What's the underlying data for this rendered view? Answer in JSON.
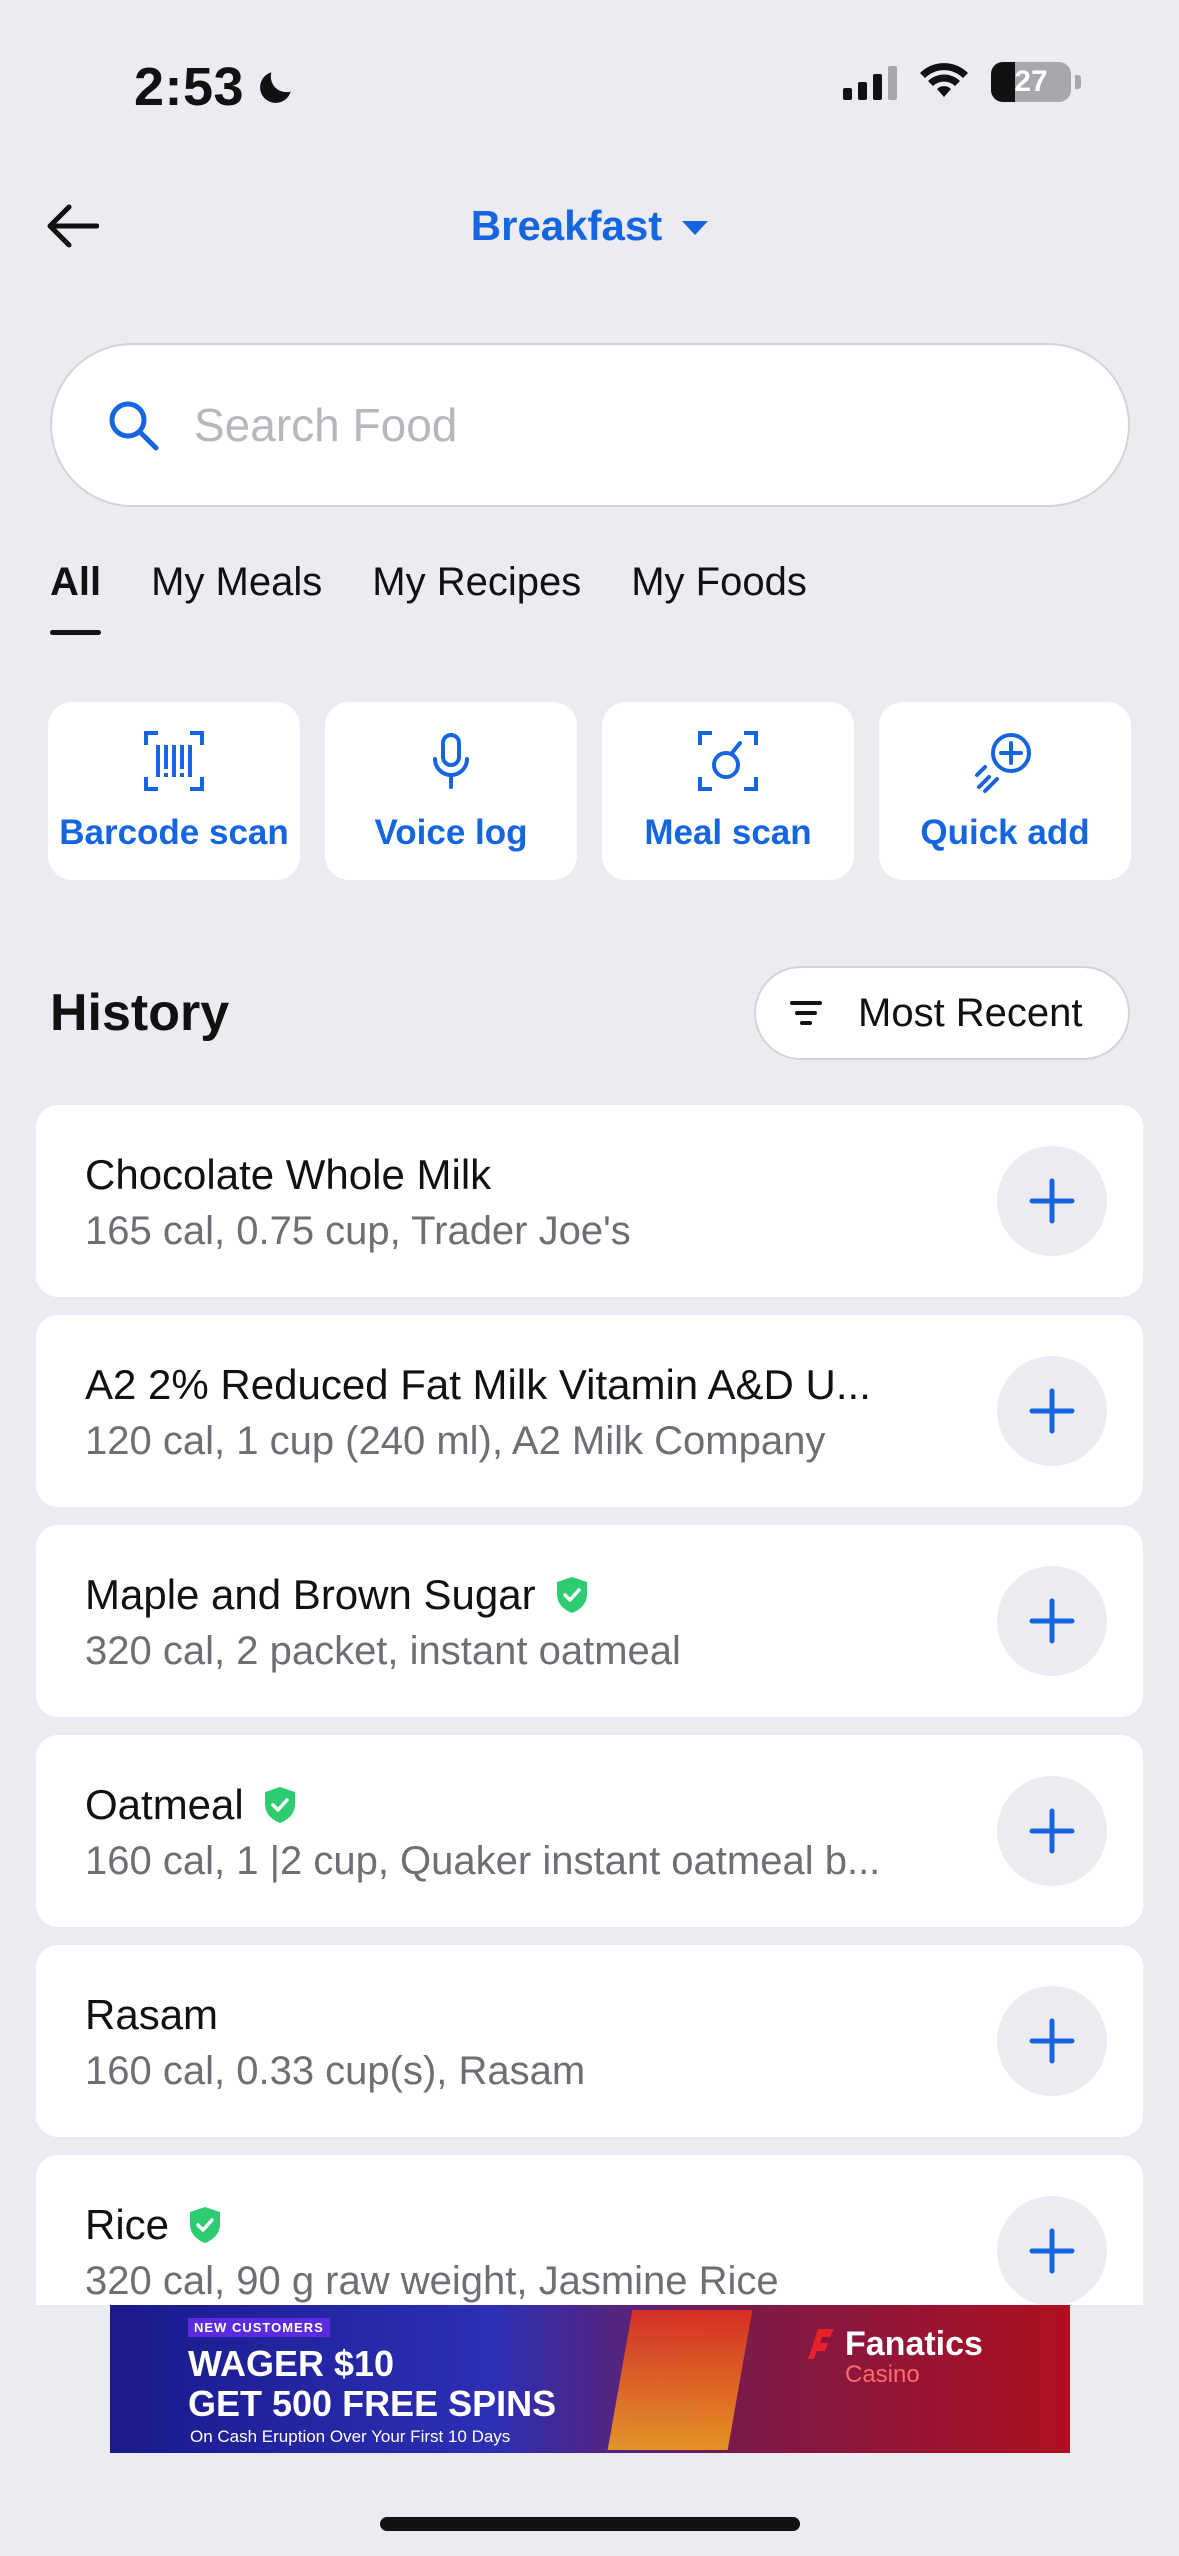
{
  "status_bar": {
    "time": "2:53",
    "battery": "27"
  },
  "nav": {
    "meal": "Breakfast"
  },
  "search": {
    "placeholder": "Search Food"
  },
  "tabs": [
    "All",
    "My Meals",
    "My Recipes",
    "My Foods"
  ],
  "actions": [
    {
      "label": "Barcode scan",
      "icon": "barcode-scan-icon"
    },
    {
      "label": "Voice log",
      "icon": "microphone-icon"
    },
    {
      "label": "Meal scan",
      "icon": "meal-scan-icon"
    },
    {
      "label": "Quick add",
      "icon": "quick-add-icon"
    }
  ],
  "history": {
    "title": "History",
    "sort_label": "Most Recent",
    "items": [
      {
        "name": "Chocolate Whole Milk",
        "detail": "165 cal, 0.75 cup, Trader Joe's",
        "verified": false
      },
      {
        "name": "A2 2% Reduced Fat Milk Vitamin A&D U...",
        "detail": "120 cal, 1 cup (240 ml), A2 Milk Company",
        "verified": false
      },
      {
        "name": "Maple and Brown Sugar",
        "detail": "320 cal, 2 packet, instant oatmeal",
        "verified": true
      },
      {
        "name": "Oatmeal",
        "detail": "160 cal, 1 |2 cup, Quaker instant oatmeal b...",
        "verified": true
      },
      {
        "name": "Rasam",
        "detail": "160 cal, 0.33 cup(s), Rasam",
        "verified": false
      },
      {
        "name": "Rice",
        "detail": "320 cal, 90 g raw weight, Jasmine  Rice",
        "verified": true
      }
    ]
  },
  "ad": {
    "badge": "NEW CUSTOMERS",
    "line1": "WAGER $10",
    "line2": "GET 500 FREE SPINS",
    "line3": "On Cash Eruption Over Your First 10 Days",
    "brand": "Fanatics",
    "brand_sub": "Casino"
  },
  "colors": {
    "accent": "#1565E0",
    "background": "#EBEBF1",
    "verified": "#2ECC71"
  }
}
